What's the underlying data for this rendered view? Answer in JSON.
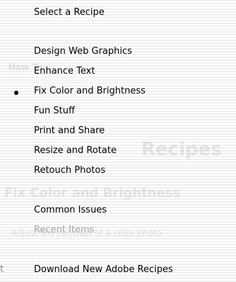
{
  "background_ghost_text": {
    "panel_heading": "How To",
    "recipes_title": "Recipes",
    "section_title": "Fix Color and Brightness",
    "description": "Adjust the contrast of a color photo",
    "bottom_fragment": "t"
  },
  "menu": {
    "items": [
      {
        "label": "Select a Recipe",
        "checked": false,
        "enabled": true
      },
      {
        "label": "Design Web Graphics",
        "checked": false,
        "enabled": true
      },
      {
        "label": "Enhance Text",
        "checked": false,
        "enabled": true
      },
      {
        "label": "Fix Color and Brightness",
        "checked": true,
        "enabled": true
      },
      {
        "label": "Fun Stuff",
        "checked": false,
        "enabled": true
      },
      {
        "label": "Print and Share",
        "checked": false,
        "enabled": true
      },
      {
        "label": "Resize and Rotate",
        "checked": false,
        "enabled": true
      },
      {
        "label": "Retouch Photos",
        "checked": false,
        "enabled": true
      },
      {
        "label": "Common Issues",
        "checked": false,
        "enabled": true
      },
      {
        "label": "Recent Items",
        "checked": false,
        "enabled": false
      },
      {
        "label": "Download New Adobe Recipes",
        "checked": false,
        "enabled": true
      }
    ]
  }
}
